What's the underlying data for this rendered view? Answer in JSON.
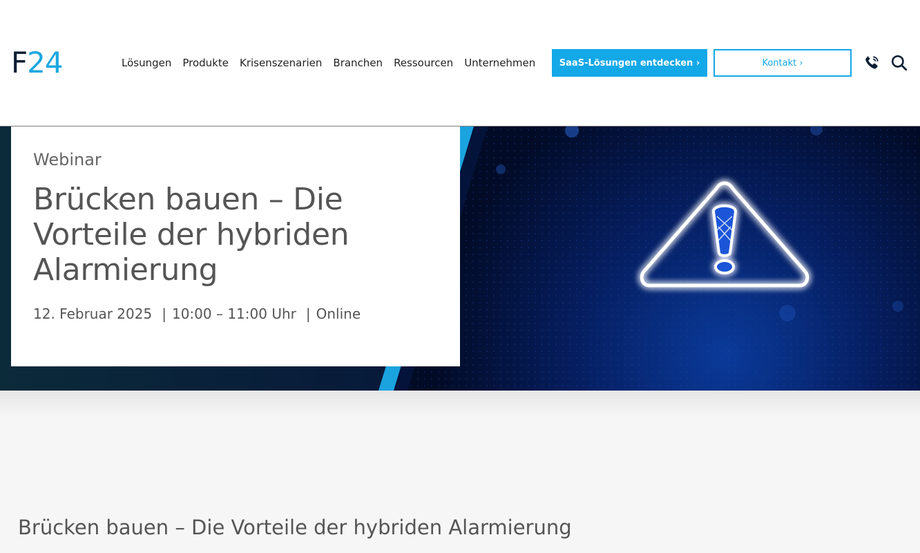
{
  "header": {
    "logo": {
      "letter": "F",
      "number": "24"
    },
    "nav": [
      "Lösungen",
      "Produkte",
      "Krisenszenarien",
      "Branchen",
      "Ressourcen",
      "Unternehmen"
    ],
    "saas_button": "SaaS-Lösungen entdecken ›",
    "kontakt_button": "Kontakt ›",
    "icons": [
      "phone-icon",
      "search-icon"
    ]
  },
  "hero": {
    "eyebrow": "Webinar",
    "title_lines": [
      "Brücken bauen – Die",
      "Vorteile der hybriden",
      "Alarmierung"
    ],
    "date": "12. Februar 2025",
    "time": "10:00 – 11:00 Uhr",
    "location": "Online",
    "separator": "|",
    "image_icon": "warning-triangle-icon"
  },
  "main": {
    "heading": "Brücken bauen – Die Vorteile der hybriden Alarmierung"
  },
  "colors": {
    "brand_blue": "#13a8e8",
    "brand_navy": "#0b1e33",
    "hero_bg": "#04133a",
    "text_gray": "#555555"
  }
}
